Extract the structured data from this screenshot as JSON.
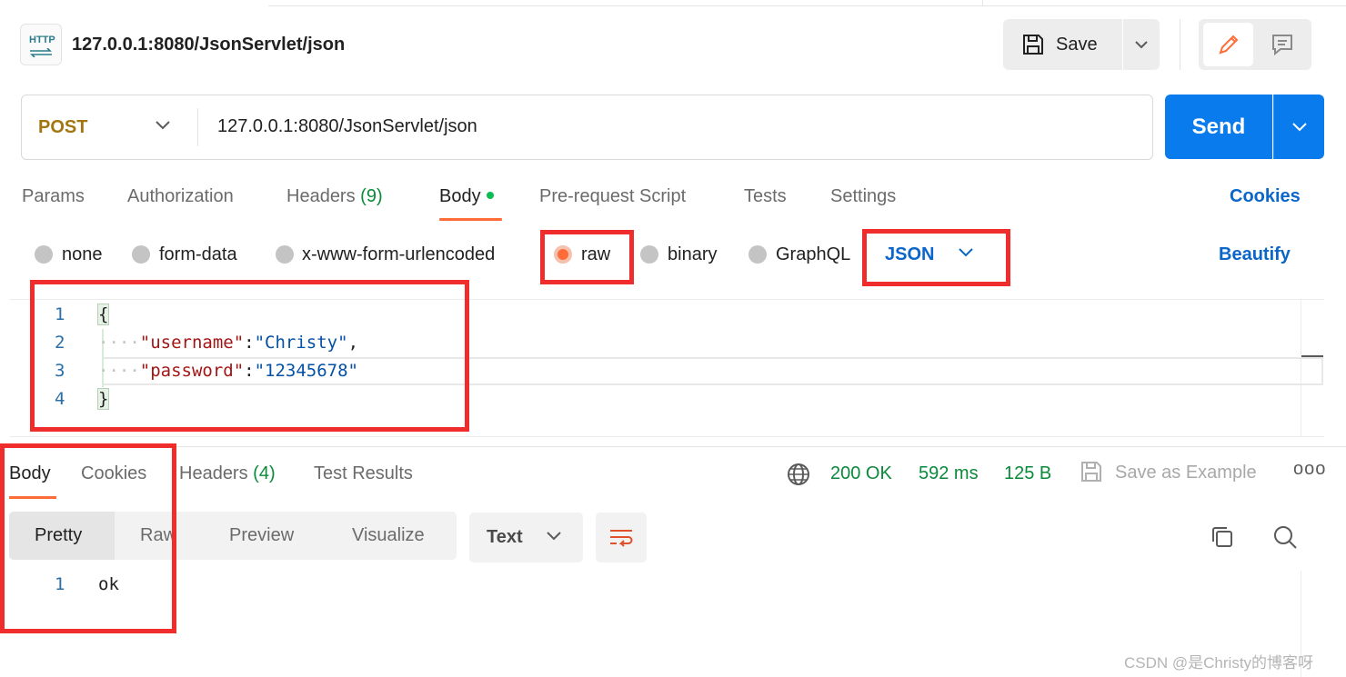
{
  "request": {
    "title": "127.0.0.1:8080/JsonServlet/json",
    "http_badge": "HTTP",
    "save_label": "Save",
    "method": "POST",
    "url": "127.0.0.1:8080/JsonServlet/json",
    "send_label": "Send"
  },
  "request_tabs": {
    "params": "Params",
    "authorization": "Authorization",
    "headers": "Headers",
    "headers_count": "(9)",
    "body": "Body",
    "pre_request": "Pre-request Script",
    "tests": "Tests",
    "settings": "Settings",
    "cookies": "Cookies"
  },
  "body_types": {
    "none": "none",
    "form_data": "form-data",
    "urlencoded": "x-www-form-urlencoded",
    "raw": "raw",
    "binary": "binary",
    "graphql": "GraphQL",
    "selected": "raw",
    "format": "JSON",
    "beautify": "Beautify"
  },
  "editor": {
    "line_numbers": [
      "1",
      "2",
      "3",
      "4"
    ],
    "open_brace": "{",
    "close_brace": "}",
    "indent": "····",
    "lines": [
      {
        "key": "\"username\"",
        "colon": ":",
        "value": "\"Christy\"",
        "trail": ","
      },
      {
        "key": "\"password\"",
        "colon": ":",
        "value": "\"12345678\"",
        "trail": ""
      }
    ]
  },
  "response_tabs": {
    "body": "Body",
    "cookies": "Cookies",
    "headers": "Headers",
    "headers_count": "(4)",
    "test_results": "Test Results"
  },
  "response_meta": {
    "status": "200 OK",
    "time": "592 ms",
    "size": "125 B",
    "save_example": "Save as Example",
    "more": "ooo"
  },
  "response_view": {
    "pretty": "Pretty",
    "raw": "Raw",
    "preview": "Preview",
    "visualize": "Visualize",
    "format": "Text",
    "line_number": "1",
    "content": "ok"
  },
  "watermark": "CSDN @是Christy的博客呀",
  "colors": {
    "accent": "#ff6c37",
    "send": "#097bed",
    "link": "#0b66c9",
    "success": "#0a8a3a",
    "highlight": "#f02d2d"
  }
}
